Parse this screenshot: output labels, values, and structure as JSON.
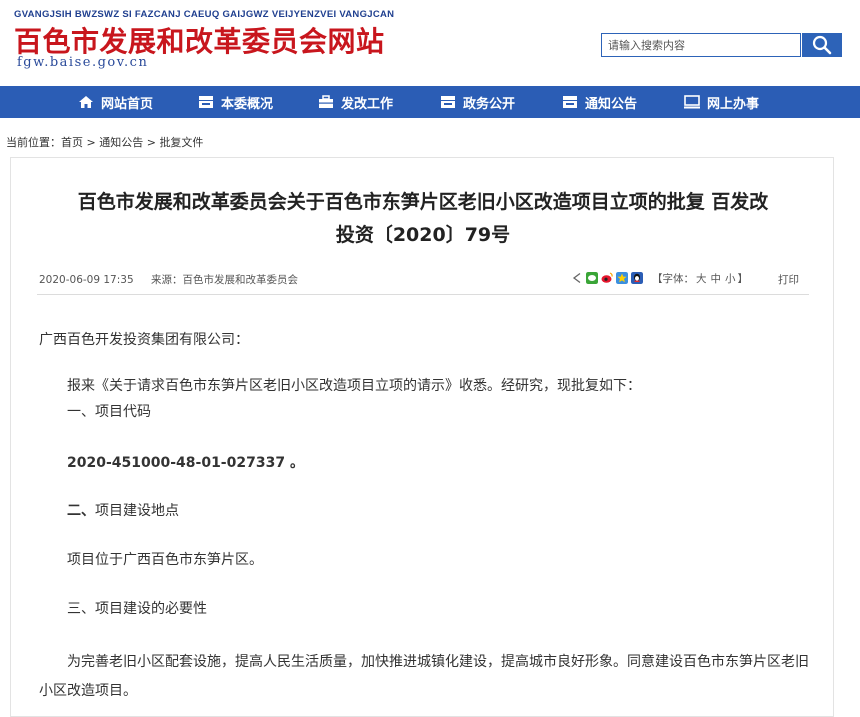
{
  "header": {
    "pinyin": "GVANGJSIH BWZSWZ SI FAZCANJ CAEUQ GAIJGWZ VEIJYENZVEI VANGJCAN",
    "title": "百色市发展和改革委员会网站",
    "domain": "fgw.baise.gov.cn",
    "search": {
      "placeholder": "请输入搜索内容"
    }
  },
  "nav": {
    "items": [
      {
        "label": "网站首页",
        "icon": "home-icon"
      },
      {
        "label": "本委概况",
        "icon": "building-icon"
      },
      {
        "label": "发改工作",
        "icon": "briefcase-icon"
      },
      {
        "label": "政务公开",
        "icon": "building-icon"
      },
      {
        "label": "通知公告",
        "icon": "building-icon"
      },
      {
        "label": "网上办事",
        "icon": "monitor-icon"
      }
    ]
  },
  "breadcrumb": {
    "prefix": "当前位置：",
    "items": [
      "首页",
      "通知公告",
      "批复文件"
    ],
    "sep": " > "
  },
  "article": {
    "title_line1": "百色市发展和改革委员会关于百色市东笋片区老旧小区改造项目立项的批复 百发改",
    "title_line2": "投资〔2020〕79号",
    "date": "2020-06-09 17:35",
    "source": "来源：百色市发展和改革委员会",
    "font_label": "【字体：",
    "font_big": "大",
    "font_mid": "中",
    "font_small": "小",
    "font_close": "】",
    "print": "打印",
    "share_icons": [
      "share-icon",
      "wechat-icon",
      "weibo-icon",
      "qzone-icon",
      "qq-icon"
    ],
    "paragraphs": {
      "salutation": "广西百色开发投资集团有限公司：",
      "p1": "报来《关于请求百色市东笋片区老旧小区改造项目立项的请示》收悉。经研究，现批复如下：",
      "h1": "一、项目代码",
      "code": "2020-451000-48-01-027337 。",
      "h2_bold": "二、",
      "h2_rest": "项目建设地点",
      "p2": "项目位于广西百色市东笋片区。",
      "h3": "三、项目建设的必要性",
      "p3": "为完善老旧小区配套设施，提高人民生活质量，加快推进城镇化建设，提高城市良好形象。同意建设百色市东笋片区老旧小区改造项目。"
    }
  },
  "colors": {
    "brand_red": "#c8161d",
    "nav_blue": "#2b5db5",
    "search_blue": "#2d63b8"
  }
}
